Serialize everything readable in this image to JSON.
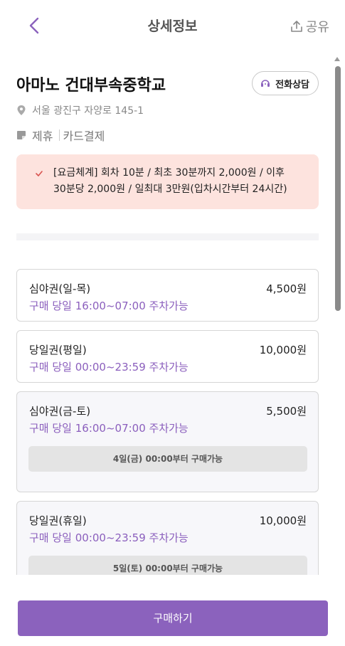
{
  "header": {
    "title": "상세정보",
    "share_label": "공유"
  },
  "lot": {
    "name": "아마노 건대부속중학교",
    "call_label": "전화상담",
    "address": "서울 광진구 자양로 145-1",
    "tags": [
      "제휴",
      "카드결제"
    ]
  },
  "notice": {
    "line1": "[요금체계] 회차 10분 / 최초 30분까지 2,000원 / 이후",
    "line2": "30분당 2,000원 / 일최대 3만원(입차시간부터 24시간)"
  },
  "tickets": [
    {
      "name": "심야권(일-목)",
      "price": "4,500원",
      "time": "구매 당일 16:00~07:00 주차가능",
      "note": ""
    },
    {
      "name": "당일권(평일)",
      "price": "10,000원",
      "time": "구매 당일 00:00~23:59 주차가능",
      "note": ""
    },
    {
      "name": "심야권(금-토)",
      "price": "5,500원",
      "time": "구매 당일 16:00~07:00 주차가능",
      "note": "4일(금) 00:00부터 구매가능"
    },
    {
      "name": "당일권(휴일)",
      "price": "10,000원",
      "time": "구매 당일 00:00~23:59 주차가능",
      "note": "5일(토) 00:00부터 구매가능"
    }
  ],
  "footer": {
    "buy_label": "구매하기"
  },
  "colors": {
    "accent": "#8b62bd",
    "notice_bg": "#fde3de",
    "notice_check": "#d9534f"
  },
  "icons": {
    "back": "chevron-left-icon",
    "share": "share-upload-icon",
    "call": "headset-icon",
    "location": "location-pin-icon",
    "tag": "tag-icon",
    "check": "check-icon"
  }
}
